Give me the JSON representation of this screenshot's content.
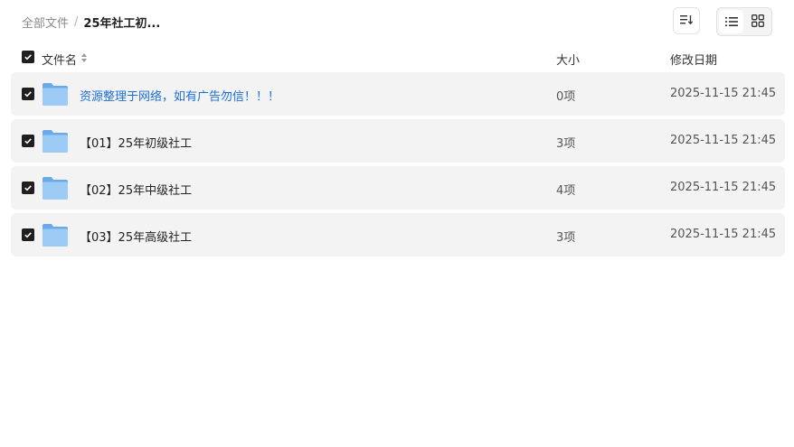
{
  "breadcrumb": {
    "root": "全部文件",
    "separator": "/",
    "current": "25年社工初..."
  },
  "toolbar": {
    "sort_icon": "sort-lines-icon",
    "list_view_icon": "list-view-icon",
    "grid_view_icon": "grid-view-icon"
  },
  "table": {
    "headers": {
      "name": "文件名",
      "size": "大小",
      "date": "修改日期"
    },
    "rows": [
      {
        "name": "资源整理于网络，如有广告勿信！！！",
        "size": "0项",
        "date": "2025-11-15 21:45"
      },
      {
        "name": "【01】25年初级社工",
        "size": "3项",
        "date": "2025-11-15 21:45"
      },
      {
        "name": "【02】25年中级社工",
        "size": "4项",
        "date": "2025-11-15 21:45"
      },
      {
        "name": "【03】25年高级社工",
        "size": "3项",
        "date": "2025-11-15 21:45"
      }
    ]
  },
  "colors": {
    "folder": "#7db7f0",
    "link": "#1d6fd8",
    "row_bg": "#f3f3f3"
  }
}
